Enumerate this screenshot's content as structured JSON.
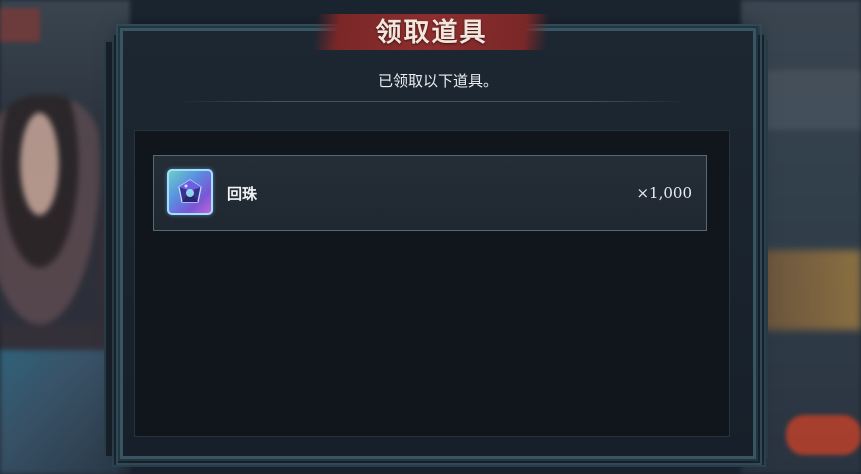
{
  "dialog": {
    "title": "领取道具",
    "message": "已领取以下道具。"
  },
  "items": [
    {
      "name": "回珠",
      "quantity": "×1,000",
      "icon": "bead-gem-icon"
    }
  ],
  "colors": {
    "title_ribbon": "#8e2e2e",
    "frame_border": "#3a5562",
    "panel_bg": "#10161c",
    "row_bg": "#252e37"
  }
}
